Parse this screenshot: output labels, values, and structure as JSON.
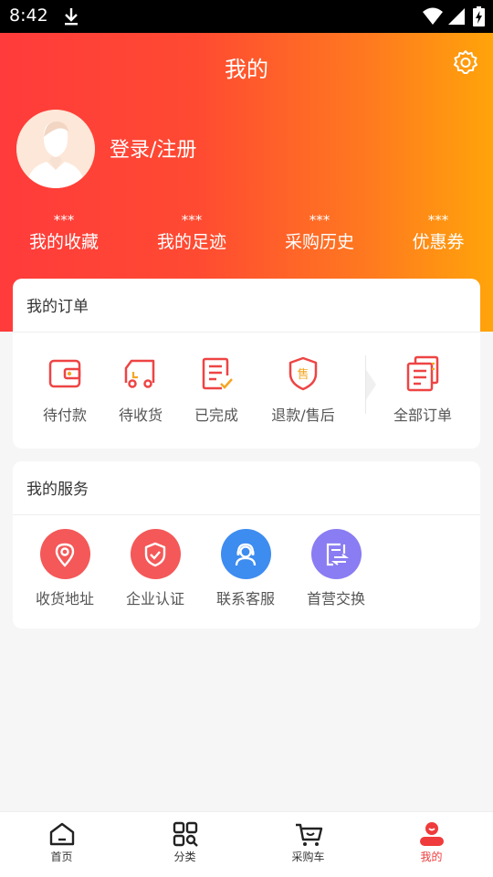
{
  "status_bar": {
    "time": "8:42"
  },
  "header": {
    "title": "我的",
    "login_label": "登录/注册",
    "stats": [
      {
        "value": "***",
        "label": "我的收藏"
      },
      {
        "value": "***",
        "label": "我的足迹"
      },
      {
        "value": "***",
        "label": "采购历史"
      },
      {
        "value": "***",
        "label": "优惠券"
      }
    ]
  },
  "orders": {
    "title": "我的订单",
    "items": [
      {
        "label": "待付款",
        "icon": "wallet-icon"
      },
      {
        "label": "待收货",
        "icon": "truck-icon"
      },
      {
        "label": "已完成",
        "icon": "checklist-icon"
      },
      {
        "label": "退款/售后",
        "icon": "shield-sale-icon"
      },
      {
        "label": "全部订单",
        "icon": "documents-icon"
      }
    ]
  },
  "services": {
    "title": "我的服务",
    "items": [
      {
        "label": "收货地址",
        "icon": "location-pin-icon",
        "color": "#f55a5a"
      },
      {
        "label": "企业认证",
        "icon": "shield-check-icon",
        "color": "#f55a5a"
      },
      {
        "label": "联系客服",
        "icon": "headset-agent-icon",
        "color": "#3d8cf0"
      },
      {
        "label": "首营交换",
        "icon": "exchange-doc-icon",
        "color": "#8a7cf2"
      }
    ]
  },
  "tab_bar": {
    "tabs": [
      {
        "label": "首页",
        "icon": "home-icon"
      },
      {
        "label": "分类",
        "icon": "category-icon"
      },
      {
        "label": "采购车",
        "icon": "cart-icon"
      },
      {
        "label": "我的",
        "icon": "profile-icon",
        "active": true
      }
    ]
  },
  "colors": {
    "brand_red": "#ef3b3b",
    "gradient_start": "#ff3b3b",
    "gradient_end": "#ffa40a",
    "service_blue": "#3d8cf0",
    "service_purple": "#8a7cf2"
  }
}
